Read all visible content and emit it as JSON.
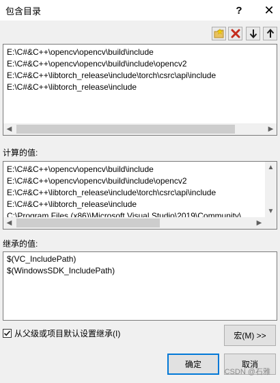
{
  "window": {
    "title": "包含目录",
    "help_label": "?",
    "close_label": "✕"
  },
  "toolbar": {
    "buttons": [
      {
        "name": "new-line",
        "icon": "new-folder-icon"
      },
      {
        "name": "delete",
        "icon": "delete-x-icon",
        "color": "#c42b1c"
      },
      {
        "name": "move-down",
        "icon": "arrow-down-icon"
      },
      {
        "name": "move-up",
        "icon": "arrow-up-icon"
      }
    ]
  },
  "include_list": {
    "lines": [
      "E:\\C#&C++\\opencv\\opencv\\build\\include",
      "E:\\C#&C++\\opencv\\opencv\\build\\include\\opencv2",
      "E:\\C#&C++\\libtorch_release\\include\\torch\\csrc\\api\\include",
      "E:\\C#&C++\\libtorch_release\\include"
    ]
  },
  "computed": {
    "label": "计算的值:",
    "lines": [
      "E:\\C#&C++\\opencv\\opencv\\build\\include",
      "E:\\C#&C++\\opencv\\opencv\\build\\include\\opencv2",
      "E:\\C#&C++\\libtorch_release\\include\\torch\\csrc\\api\\include",
      "E:\\C#&C++\\libtorch_release\\include",
      "C:\\Program Files (x86)\\Microsoft Visual Studio\\2019\\Community\\"
    ]
  },
  "inherited": {
    "label": "继承的值:",
    "lines": [
      "$(VC_IncludePath)",
      "$(WindowsSDK_IncludePath)"
    ]
  },
  "inherit_checkbox": {
    "checked": true,
    "label": "从父级或项目默认设置继承(I)"
  },
  "buttons": {
    "macro": "宏(M) >>",
    "ok": "确定",
    "cancel": "取消"
  },
  "watermark": "CSDN @石雅",
  "colors": {
    "accent": "#0078d7",
    "delete": "#c42b1c"
  }
}
